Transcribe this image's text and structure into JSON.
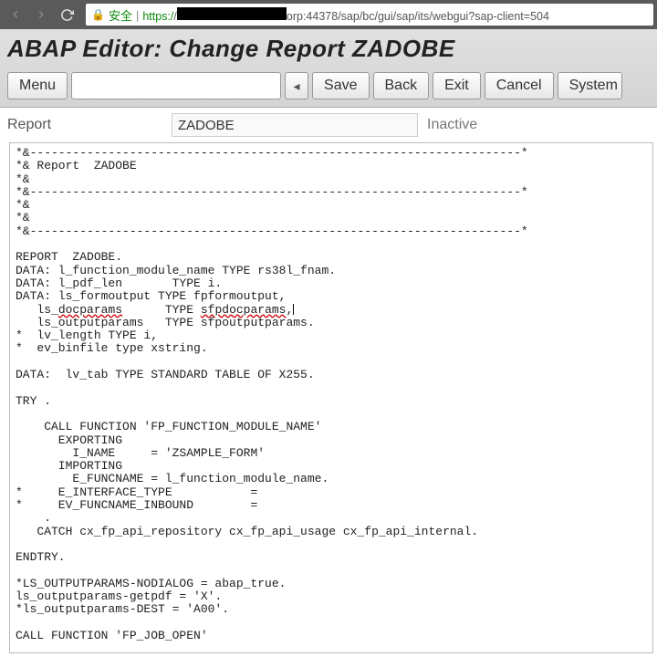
{
  "browser": {
    "secure_label": "安全",
    "url_prefix": "https:/",
    "url_suffix": "orp:44378/sap/bc/gui/sap/its/webgui?sap-client=504"
  },
  "header": {
    "title": "ABAP Editor: Change Report ZADOBE"
  },
  "toolbar": {
    "menu": "Menu",
    "dropdown": "◂",
    "save": "Save",
    "back": "Back",
    "exit": "Exit",
    "cancel": "Cancel",
    "system": "System"
  },
  "info": {
    "label": "Report",
    "value": "ZADOBE",
    "status": "Inactive"
  },
  "code": {
    "l01": "*&---------------------------------------------------------------------*",
    "l02": "*& Report  ZADOBE",
    "l03": "*&",
    "l04": "*&---------------------------------------------------------------------*",
    "l05": "*&",
    "l06": "*&",
    "l07": "*&---------------------------------------------------------------------*",
    "l08": "",
    "l09": "REPORT  ZADOBE.",
    "l10": "DATA: l_function_module_name TYPE rs38l_fnam.",
    "l11": "DATA: l_pdf_len       TYPE i.",
    "l12": "DATA: ls_formoutput TYPE fpformoutput,",
    "l13a": "   ls_",
    "l13b": "docparams",
    "l13c": "      TYPE ",
    "l13d": "sfpdocparams",
    "l13e": ",",
    "l14": "   ls_outputparams   TYPE sfpoutputparams.",
    "l15": "*  lv_length TYPE i,",
    "l16": "*  ev_binfile type xstring.",
    "l17": "",
    "l18": "DATA:  lv_tab TYPE STANDARD TABLE OF X255.",
    "l19": "",
    "l20": "TRY .",
    "l21": "",
    "l22": "    CALL FUNCTION 'FP_FUNCTION_MODULE_NAME'",
    "l23": "      EXPORTING",
    "l24": "        I_NAME     = 'ZSAMPLE_FORM'",
    "l25": "      IMPORTING",
    "l26": "        E_FUNCNAME = l_function_module_name.",
    "l27": "*     E_INTERFACE_TYPE           =",
    "l28": "*     EV_FUNCNAME_INBOUND        =",
    "l29": "    .",
    "l30": "   CATCH cx_fp_api_repository cx_fp_api_usage cx_fp_api_internal.",
    "l31": "",
    "l32": "ENDTRY.",
    "l33": "",
    "l34": "*LS_OUTPUTPARAMS-NODIALOG = abap_true.",
    "l35": "ls_outputparams-getpdf = 'X'.",
    "l36": "*ls_outputparams-DEST = 'A00'.",
    "l37": "",
    "l38": "CALL FUNCTION 'FP_JOB_OPEN'"
  }
}
